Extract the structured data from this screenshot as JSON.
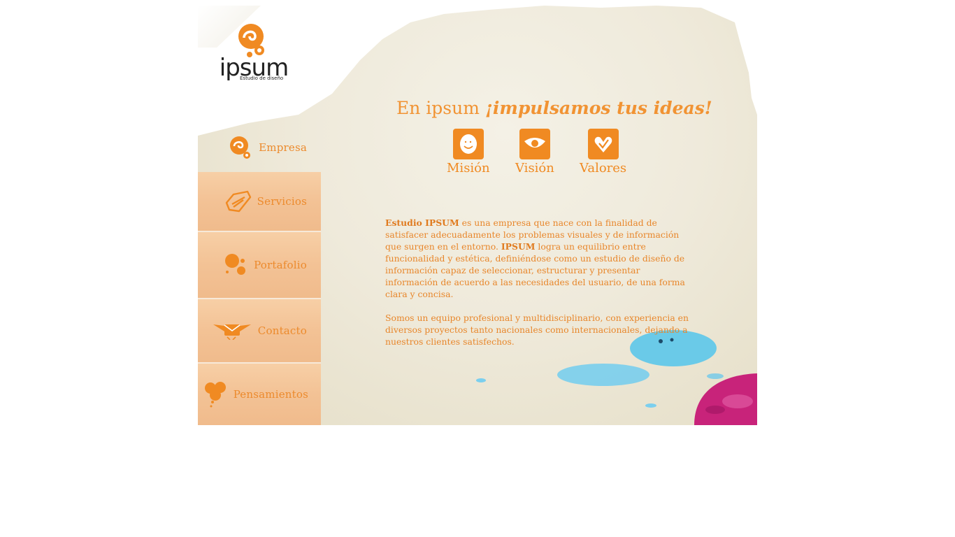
{
  "logo": {
    "name": "ipsum",
    "tagline": "Estudio de diseño"
  },
  "nav": {
    "items": [
      {
        "label": "Empresa",
        "icon": "logo-swirl-icon"
      },
      {
        "label": "Servicios",
        "icon": "handshake-icon"
      },
      {
        "label": "Portafolio",
        "icon": "splatter-icon"
      },
      {
        "label": "Contacto",
        "icon": "winged-envelope-icon"
      },
      {
        "label": "Pensamientos",
        "icon": "flower-icon"
      }
    ]
  },
  "headline": {
    "prefix": "En ipsum ",
    "emphasis": "¡impulsamos tus ideas!"
  },
  "pillars": [
    {
      "label": "Misión",
      "icon": "smiley-face-icon"
    },
    {
      "label": "Visión",
      "icon": "eye-icon"
    },
    {
      "label": "Valores",
      "icon": "heart-check-icon"
    }
  ],
  "content": {
    "p1_bold1": "Estudio IPSUM",
    "p1_text1": " es una empresa  que nace con la finalidad de satisfacer adecuadamente los problemas visuales y de información que surgen en el entorno. ",
    "p1_bold2": "IPSUM",
    "p1_text2": " logra un equilibrio entre funcionalidad y estética, definiéndose como un estudio de diseño de información capaz de seleccionar, estructurar y presentar información de acuerdo a las necesidades del usuario, de una forma clara y concisa.",
    "p2": "Somos un equipo profesional y multidisciplinario, con experiencia en diversos proyectos tanto nacionales como internacionales, dejando a nuestros clientes satisfechos."
  },
  "colors": {
    "accent": "#f08a22",
    "paper": "#efeadb",
    "tile": "#f3c295",
    "blue_splash": "#5cc6ea",
    "magenta_splash": "#c8237a"
  }
}
